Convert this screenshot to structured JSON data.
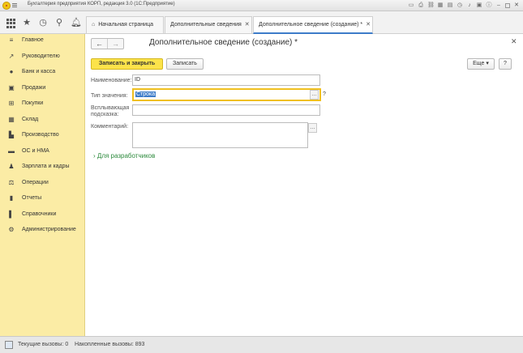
{
  "window": {
    "title": "Бухгалтерия предприятия КОРП, редакция 3.0 (1С:Предприятие)"
  },
  "tabs": [
    {
      "label": "Начальная страница"
    },
    {
      "label": "Дополнительные сведения"
    },
    {
      "label": "Дополнительное сведение (создание) *"
    }
  ],
  "sidebar": {
    "items": [
      {
        "label": "Главное",
        "icon": "menu-lines-icon"
      },
      {
        "label": "Руководителю",
        "icon": "trend-line-icon"
      },
      {
        "label": "Банк и касса",
        "icon": "coin-icon"
      },
      {
        "label": "Продажи",
        "icon": "cart-bag-icon"
      },
      {
        "label": "Покупки",
        "icon": "cart-icon"
      },
      {
        "label": "Склад",
        "icon": "warehouse-icon"
      },
      {
        "label": "Производство",
        "icon": "factory-icon"
      },
      {
        "label": "ОС и НМА",
        "icon": "truck-icon"
      },
      {
        "label": "Зарплата и кадры",
        "icon": "person-icon"
      },
      {
        "label": "Операции",
        "icon": "operations-icon"
      },
      {
        "label": "Отчеты",
        "icon": "bar-chart-icon"
      },
      {
        "label": "Справочники",
        "icon": "book-icon"
      },
      {
        "label": "Администрирование",
        "icon": "gear-icon"
      }
    ]
  },
  "form": {
    "title": "Дополнительное сведение (создание) *",
    "buttons": {
      "save_close": "Записать и закрыть",
      "save": "Записать",
      "more": "Еще",
      "help": "?"
    },
    "fields": {
      "name_label": "Наименование:",
      "name_value": "ID",
      "type_label": "Тип значения:",
      "type_value": "Строка",
      "tooltip_label_1": "Всплывающая",
      "tooltip_label_2": "подсказка:",
      "tooltip_value": "",
      "comment_label": "Комментарий:",
      "comment_value": ""
    },
    "dev_section": "Для разработчиков"
  },
  "statusbar": {
    "current_calls": "Текущие вызовы: 0",
    "accumulated_calls": "Накопленные вызовы: 893"
  }
}
